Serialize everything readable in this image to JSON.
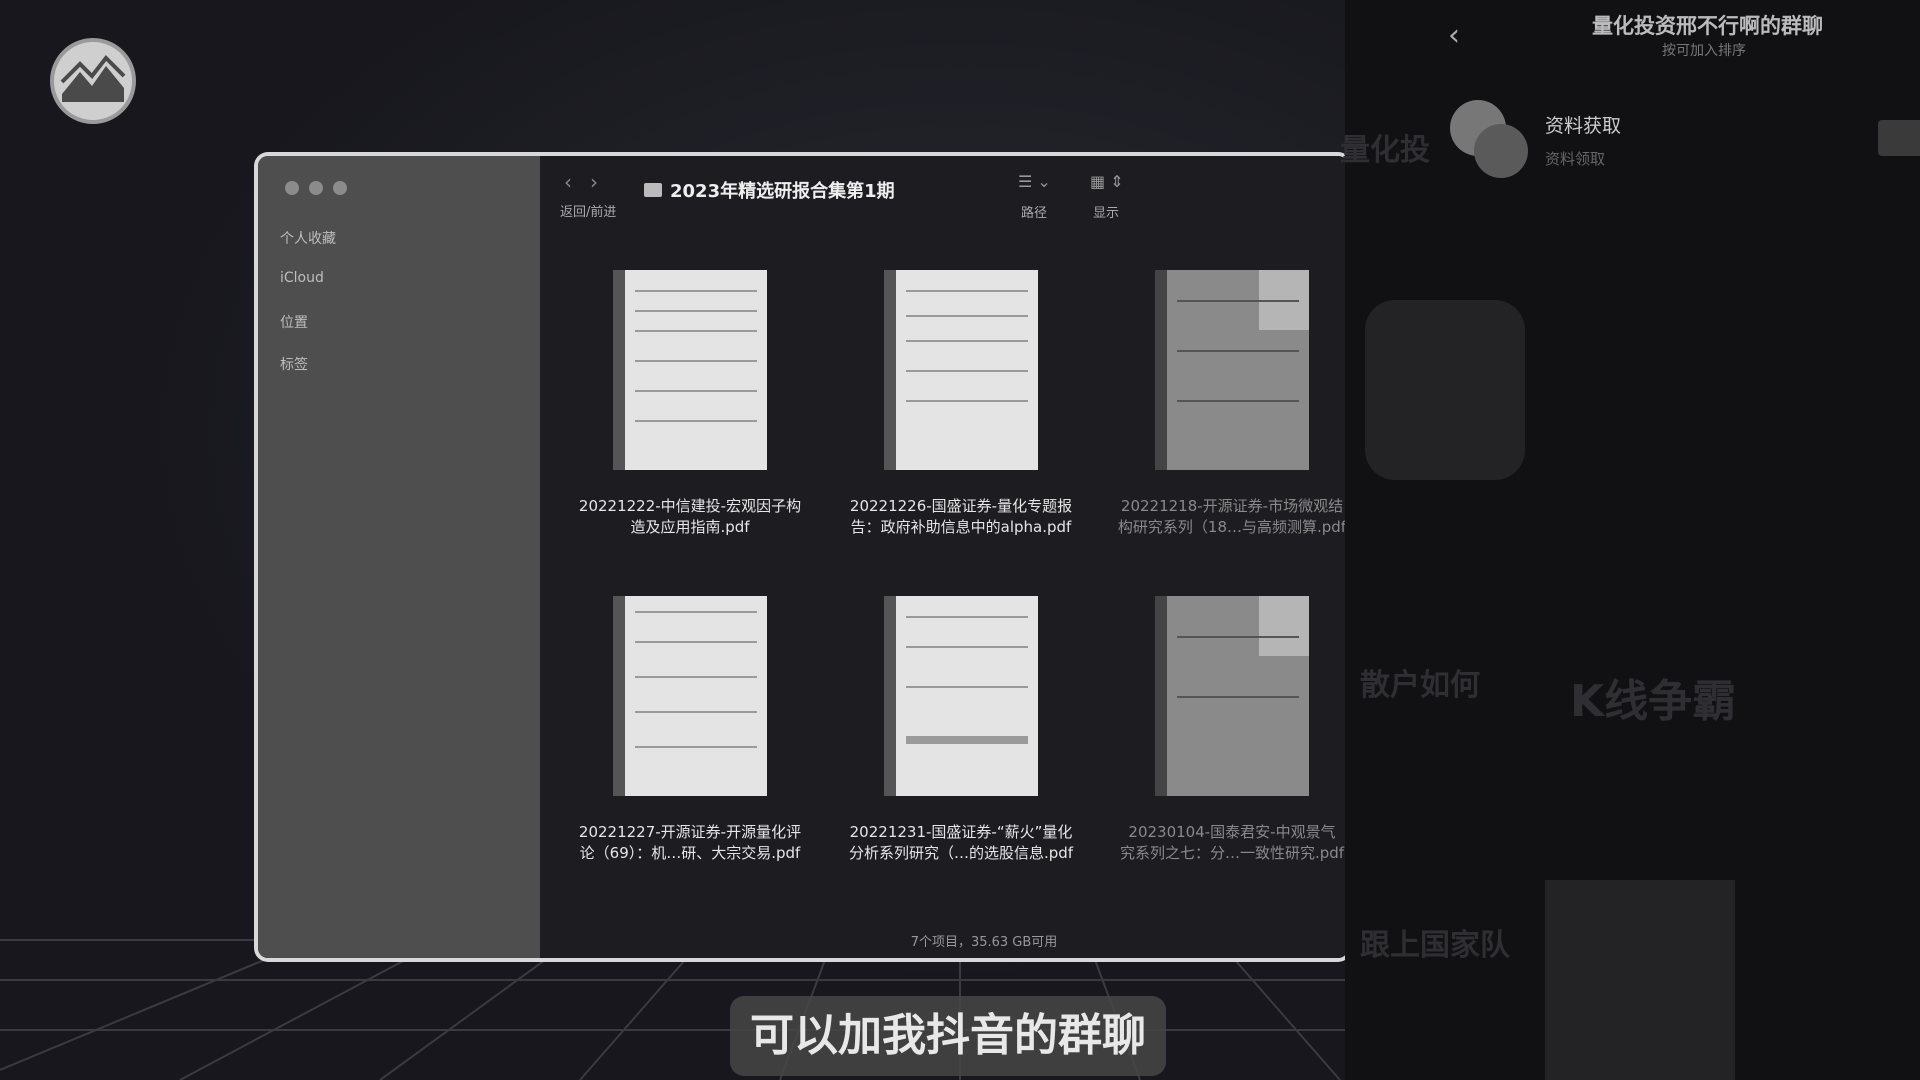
{
  "finder": {
    "nav_label": "返回/前进",
    "folder_title": "2023年精选研报合集第1期",
    "path_label": "路径",
    "display_label": "显示",
    "status": "7个项目，35.63 GB可用",
    "sidebar": [
      "个人收藏",
      "iCloud",
      "位置",
      "标签"
    ],
    "files": [
      {
        "name_line1": "20221222-中信建投-宏观因子构",
        "name_line2": "造及应用指南.pdf"
      },
      {
        "name_line1": "20221226-国盛证券-量化专题报",
        "name_line2": "告：政府补助信息中的alpha.pdf"
      },
      {
        "name_line1": "20221218-开源证券-市场微观结",
        "name_line2": "构研究系列（18…与高频测算.pdf"
      },
      {
        "name_line1": "20221227-开源证券-开源量化评",
        "name_line2": "论（69）：机…研、大宗交易.pdf"
      },
      {
        "name_line1": "20221231-国盛证券-“薪火”量化",
        "name_line2": "分析系列研究（…的选股信息.pdf"
      },
      {
        "name_line1": "20230104-国泰君安-中观景气",
        "name_line2": "究系列之七：分…一致性研究.pdf"
      }
    ]
  },
  "chat_panel": {
    "title": "量化投资邢不行啊的群聊",
    "subtitle": "按可加入排序",
    "contact_name": "资料获取",
    "contact_sub": "资料领取"
  },
  "subtitle_caption": "可以加我抖音的群聊",
  "colors": {
    "sidebar": "#4e4e4e",
    "main_bg": "#1c1c21",
    "page_bg": "#17171d"
  }
}
